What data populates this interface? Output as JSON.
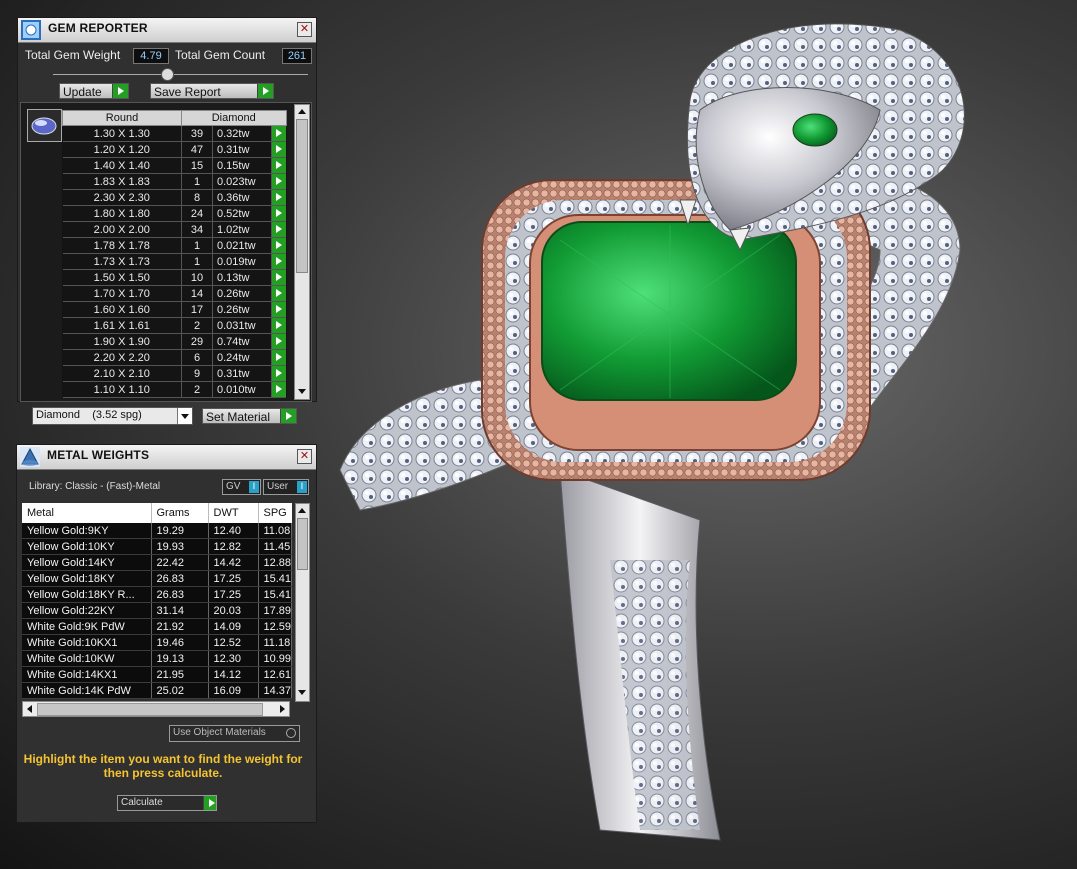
{
  "gem_reporter": {
    "title": "GEM REPORTER",
    "total_weight_label": "Total Gem Weight",
    "total_weight_value": "4.79",
    "total_count_label": "Total Gem Count",
    "total_count_value": "261",
    "update_label": "Update",
    "save_report_label": "Save Report",
    "col_shape": "Round",
    "col_material": "Diamond",
    "rows": [
      [
        "1.30 X 1.30",
        "39",
        "0.32tw"
      ],
      [
        "1.20 X 1.20",
        "47",
        "0.31tw"
      ],
      [
        "1.40 X 1.40",
        "15",
        "0.15tw"
      ],
      [
        "1.83 X 1.83",
        "1",
        "0.023tw"
      ],
      [
        "2.30 X 2.30",
        "8",
        "0.36tw"
      ],
      [
        "1.80 X 1.80",
        "24",
        "0.52tw"
      ],
      [
        "2.00 X 2.00",
        "34",
        "1.02tw"
      ],
      [
        "1.78 X 1.78",
        "1",
        "0.021tw"
      ],
      [
        "1.73 X 1.73",
        "1",
        "0.019tw"
      ],
      [
        "1.50 X 1.50",
        "10",
        "0.13tw"
      ],
      [
        "1.70 X 1.70",
        "14",
        "0.26tw"
      ],
      [
        "1.60 X 1.60",
        "17",
        "0.26tw"
      ],
      [
        "1.61 X 1.61",
        "2",
        "0.031tw"
      ],
      [
        "1.90 X 1.90",
        "29",
        "0.74tw"
      ],
      [
        "2.20 X 2.20",
        "6",
        "0.24tw"
      ],
      [
        "2.10 X 2.10",
        "9",
        "0.31tw"
      ],
      [
        "1.10 X 1.10",
        "2",
        "0.010tw"
      ]
    ],
    "material_select": "Diamond    (3.52 spg)",
    "set_material_label": "Set Material"
  },
  "metal_weights": {
    "title": "METAL WEIGHTS",
    "library_label": "Library: Classic - (Fast)-Metal",
    "gv_label": "GV",
    "user_label": "User",
    "columns": [
      "Metal",
      "Grams",
      "DWT",
      "SPG"
    ],
    "rows": [
      [
        "Yellow Gold:9KY",
        "19.29",
        "12.40",
        "11.08"
      ],
      [
        "Yellow Gold:10KY",
        "19.93",
        "12.82",
        "11.45"
      ],
      [
        "Yellow Gold:14KY",
        "22.42",
        "14.42",
        "12.88"
      ],
      [
        "Yellow Gold:18KY",
        "26.83",
        "17.25",
        "15.41"
      ],
      [
        "Yellow Gold:18KY R...",
        "26.83",
        "17.25",
        "15.41"
      ],
      [
        "Yellow Gold:22KY",
        "31.14",
        "20.03",
        "17.89"
      ],
      [
        "White Gold:9K PdW",
        "21.92",
        "14.09",
        "12.59"
      ],
      [
        "White Gold:10KX1",
        "19.46",
        "12.52",
        "11.18"
      ],
      [
        "White Gold:10KW",
        "19.13",
        "12.30",
        "10.99"
      ],
      [
        "White Gold:14KX1",
        "21.95",
        "14.12",
        "12.61"
      ],
      [
        "White Gold:14K PdW",
        "25.02",
        "16.09",
        "14.37"
      ]
    ],
    "use_object_materials_label": "Use Object Materials",
    "instructions": "Highlight the item you want to find the weight for then press calculate.",
    "calculate_label": "Calculate"
  }
}
